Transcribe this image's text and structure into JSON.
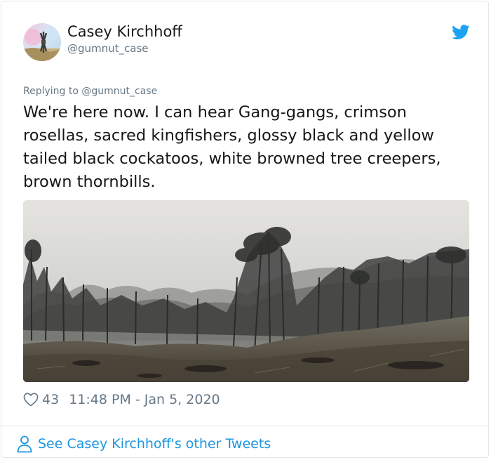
{
  "tweet": {
    "author_name": "Casey Kirchhoff",
    "author_handle": "@gumnut_case",
    "replying_to": "Replying to @gumnut_case",
    "text": "We're here now. I can hear Gang-gangs, crimson rosellas, sacred kingfishers, glossy black and yellow tailed black cockatoos, white browned tree creepers, brown thornbills.",
    "likes": "43",
    "timestamp": "11:48 PM - Jan 5, 2020",
    "footer_link": "See Casey Kirchhoff's other Tweets"
  },
  "icons": {
    "brand": "twitter-bird-icon",
    "like": "heart-icon",
    "profile": "person-icon"
  },
  "colors": {
    "twitter_blue": "#1da1f2",
    "link_blue": "#1b95e0",
    "secondary_text": "#657786",
    "border": "#e1e8ed"
  }
}
